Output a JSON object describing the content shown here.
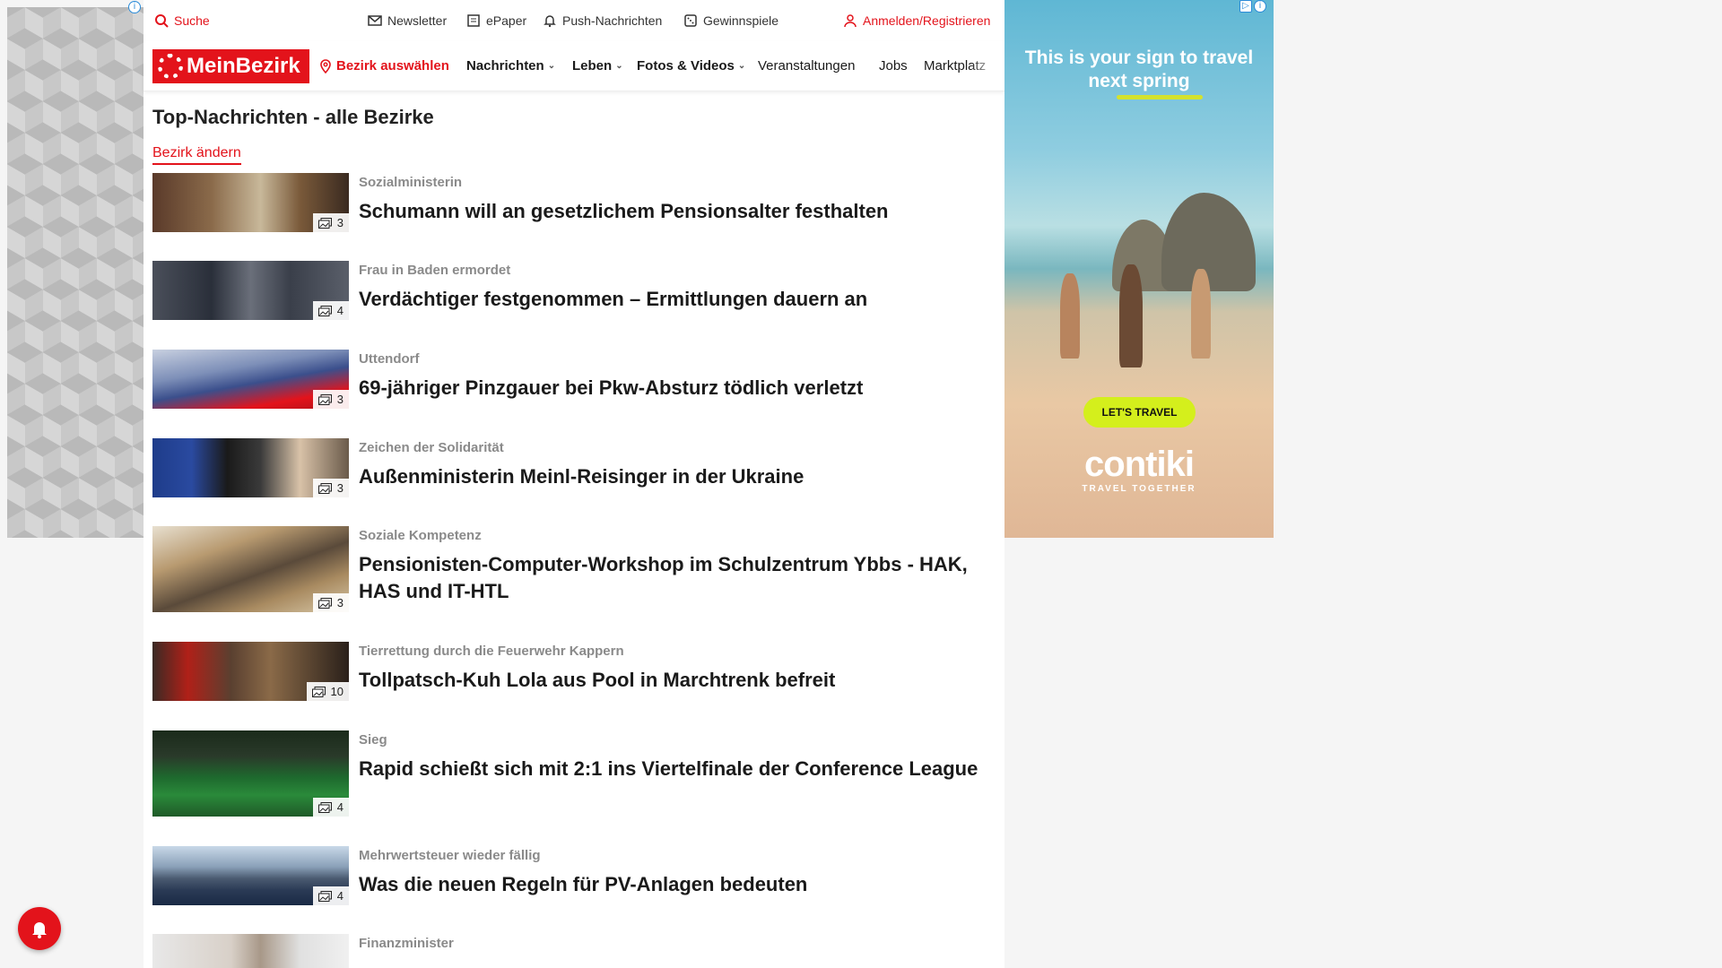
{
  "utility_bar": {
    "search_label": "Suche",
    "newsletter_label": "Newsletter",
    "epaper_label": "ePaper",
    "push_label": "Push-Nachrichten",
    "games_label": "Gewinnspiele",
    "login_label": "Anmelden/Registrieren"
  },
  "nav": {
    "logo_text": "MeinBezirk",
    "district_label": "Bezirk auswählen",
    "items": [
      {
        "label": "Nachrichten"
      },
      {
        "label": "Leben"
      },
      {
        "label": "Fotos & Videos"
      },
      {
        "label": "Veranstaltungen"
      },
      {
        "label": "Jobs"
      },
      {
        "label": "Marktplatz"
      }
    ]
  },
  "main": {
    "title": "Top-Nachrichten - alle Bezirke",
    "change_district_label": "Bezirk ändern",
    "articles": [
      {
        "kicker": "Sozialministerin",
        "headline": "Schumann will an gesetzlichem Pensionsalter festhalten",
        "image_count": "3"
      },
      {
        "kicker": "Frau in Baden ermordet",
        "headline": "Verdächtiger festgenommen – Ermittlungen dauern an",
        "image_count": "4"
      },
      {
        "kicker": "Uttendorf",
        "headline": "69-jähriger Pinzgauer bei Pkw-Absturz tödlich verletzt",
        "image_count": "3"
      },
      {
        "kicker": "Zeichen der Solidarität",
        "headline": "Außenministerin Meinl-Reisinger in der Ukraine",
        "image_count": "3"
      },
      {
        "kicker": "Soziale Kompetenz",
        "headline": "Pensionisten-Computer-Workshop im Schulzentrum Ybbs - HAK, HAS und IT-HTL",
        "image_count": "3"
      },
      {
        "kicker": "Tierrettung durch die Feuerwehr Kappern",
        "headline": "Tollpatsch-Kuh Lola aus Pool in Marchtrenk befreit",
        "image_count": "10"
      },
      {
        "kicker": "Sieg",
        "headline": "Rapid schießt sich mit 2:1 ins Viertelfinale der Conference League",
        "image_count": "4"
      },
      {
        "kicker": "Mehrwertsteuer wieder fällig",
        "headline": "Was die neuen Regeln für PV-Anlagen bedeuten",
        "image_count": "4"
      },
      {
        "kicker": "Finanzminister",
        "headline": "",
        "image_count": ""
      }
    ]
  },
  "ad": {
    "headline": "This is your sign to travel next spring",
    "cta": "LET'S TRAVEL",
    "brand": "contiki",
    "tagline": "TRAVEL TOGETHER"
  },
  "colors": {
    "brand_red": "#e3131b",
    "ad_accent": "#d4ef1c"
  },
  "icons": {
    "search": "search-icon",
    "newsletter": "mail-icon",
    "epaper": "newspaper-icon",
    "push": "bell-icon",
    "games": "dice-icon",
    "login": "user-icon",
    "location": "map-pin-icon",
    "gallery": "image-gallery-icon"
  }
}
